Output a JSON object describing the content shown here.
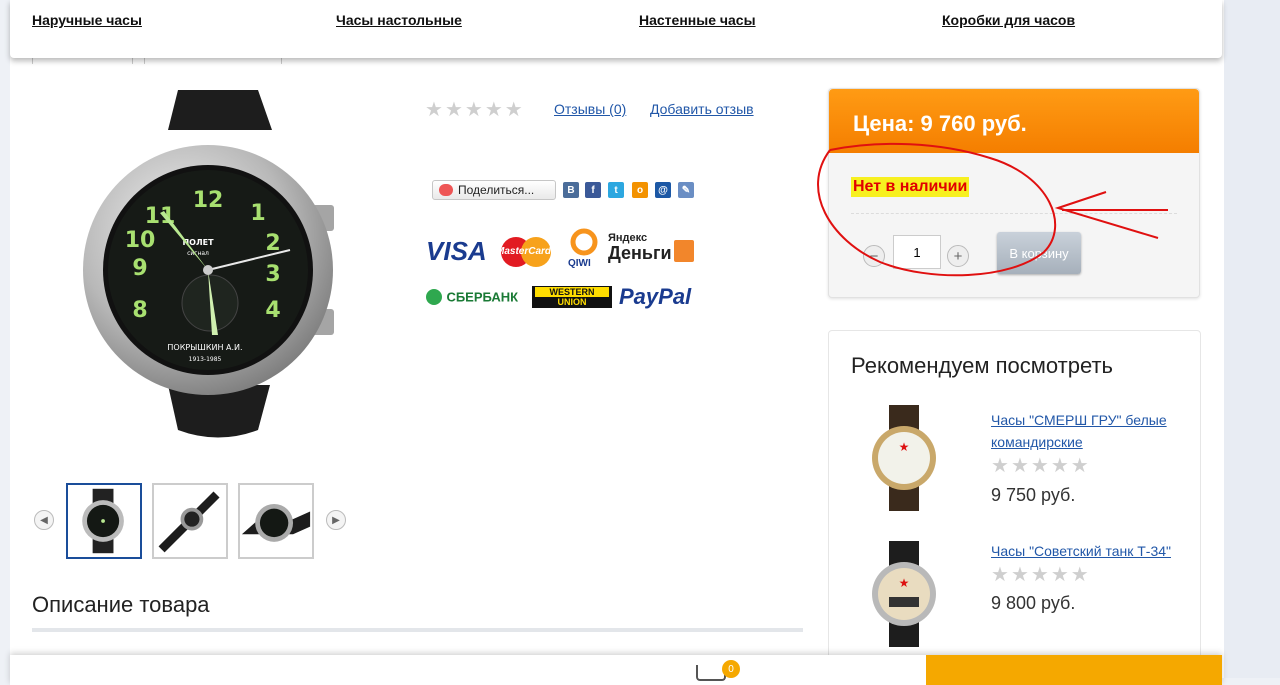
{
  "nav": {
    "items": [
      "Наручные часы",
      "Часы настольные",
      "Настенные часы",
      "Коробки для часов"
    ]
  },
  "product": {
    "dial_brand": "ПОЛЕТ",
    "dial_sub": "сигнал",
    "dial_name": "ПОКРЫШКИН А.И.",
    "dial_years": "1913-1985",
    "rating_stars": 0,
    "reviews_link": "Отзывы (0)",
    "add_review_link": "Добавить отзыв",
    "share_label": "Поделиться...",
    "description_title": "Описание товара"
  },
  "payments": {
    "visa": "VISA",
    "mastercard": "MasterCard",
    "qiwi": "QIWI",
    "yandex_line1": "Яндекс",
    "yandex_line2": "Деньги",
    "sberbank": "СБЕРБАНК",
    "western_union_line1": "WESTERN",
    "western_union_line2": "UNION",
    "paypal": "PayPal"
  },
  "buy_box": {
    "price": "Цена: 9 760 руб.",
    "stock_status": "Нет в наличии",
    "quantity_value": "1",
    "add_to_cart": "В корзину"
  },
  "recommended": {
    "title": "Рекомендуем посмотреть",
    "items": [
      {
        "name": "Часы \"СМЕРШ ГРУ\" белые командирские",
        "price": "9 750 руб.",
        "rating_stars": 0
      },
      {
        "name": "Часы \"Советский танк Т-34\"",
        "price": "9 800 руб.",
        "rating_stars": 0
      }
    ]
  },
  "bottom_bar": {
    "cart_count": "0"
  },
  "colors": {
    "accent_orange": "#f47e00",
    "link_blue": "#2157a8",
    "out_of_stock_red": "#e00000",
    "highlight_yellow": "#f7f020",
    "annotation_red": "#e01010"
  }
}
